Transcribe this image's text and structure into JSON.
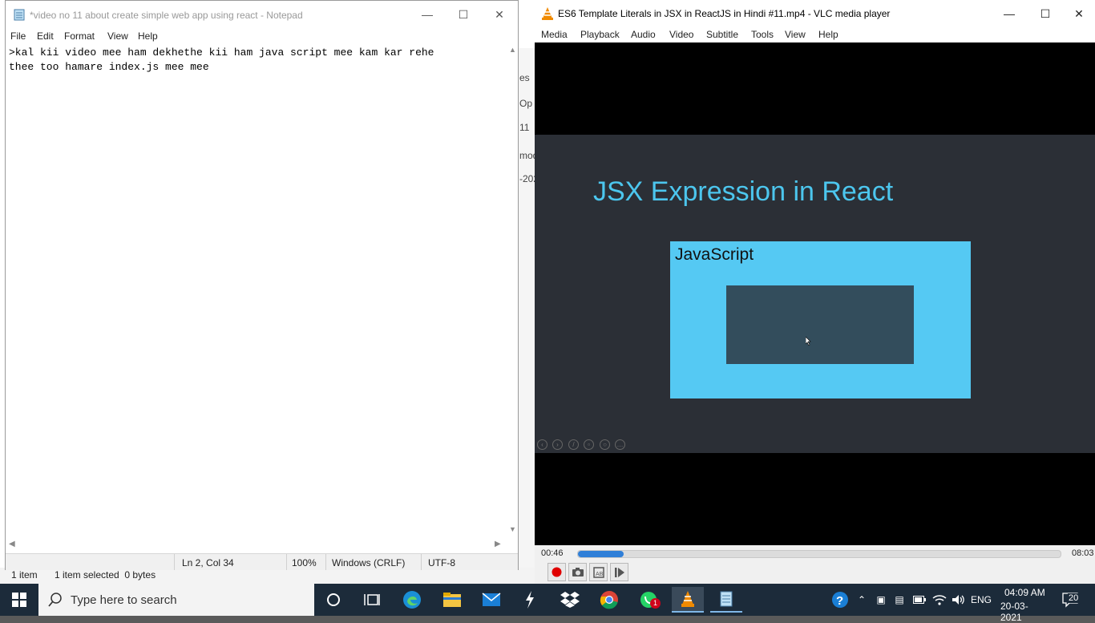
{
  "explorer": {
    "status_items": "1 item",
    "status_selected": "1 item selected  0 bytes",
    "strip_fragments": [
      "es",
      "Op",
      "11",
      "mod",
      "-202"
    ]
  },
  "notepad": {
    "title": "*video no 11 about create simple web app using react - Notepad",
    "menu": [
      "File",
      "Edit",
      "Format",
      "View",
      "Help"
    ],
    "text_lines": [
      ">kal kii video mee ham dekhethe kii ham java script mee kam kar rehe",
      "thee too hamare index.js mee mee"
    ],
    "status": {
      "position": "Ln 2, Col 34",
      "zoom": "100%",
      "line_ending": "Windows (CRLF)",
      "encoding": "UTF-8"
    }
  },
  "vlc": {
    "title": "ES6 Template Literals in JSX in ReactJS in Hindi #11.mp4 - VLC media player",
    "menu": [
      "Media",
      "Playback",
      "Audio",
      "Video",
      "Subtitle",
      "Tools",
      "View",
      "Help"
    ],
    "slide_title": "JSX Expression in React",
    "slide_box_label": "JavaScript",
    "time_elapsed": "00:46",
    "time_total": "08:03",
    "progress_fraction": 0.095,
    "accent_color": "#2f7fd8"
  },
  "taskbar": {
    "search_placeholder": "Type here to search",
    "whatsapp_badge": "1",
    "language": "ENG",
    "time": "04:09 AM",
    "date": "20-03-2021",
    "notification_count": "20"
  }
}
